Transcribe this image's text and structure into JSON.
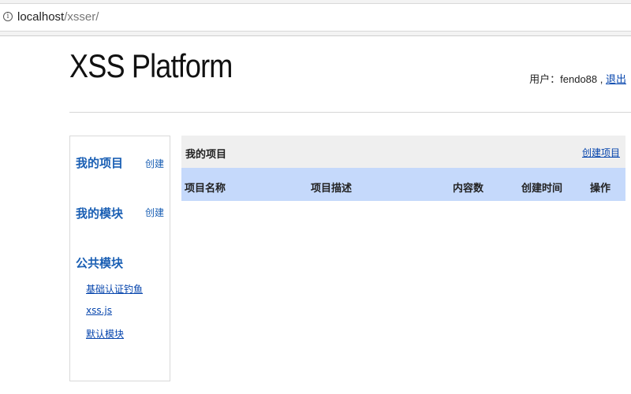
{
  "browser": {
    "url_host": "localhost",
    "url_path": "/xsser/"
  },
  "header": {
    "site_title": "XSS Platform",
    "user_label": "用户：fendo88 ,",
    "logout_label": "退出"
  },
  "sidebar": {
    "my_projects": {
      "label": "我的项目",
      "create_label": "创建"
    },
    "my_modules": {
      "label": "我的模块",
      "create_label": "创建"
    },
    "public_modules": {
      "label": "公共模块",
      "items": [
        {
          "label": "基础认证钓鱼"
        },
        {
          "label": "xss.js"
        },
        {
          "label": "默认模块"
        }
      ]
    }
  },
  "main": {
    "panel_title": "我的项目",
    "create_project_label": "创建项目",
    "columns": [
      "项目名称",
      "项目描述",
      "内容数",
      "创建时间",
      "操作"
    ]
  }
}
